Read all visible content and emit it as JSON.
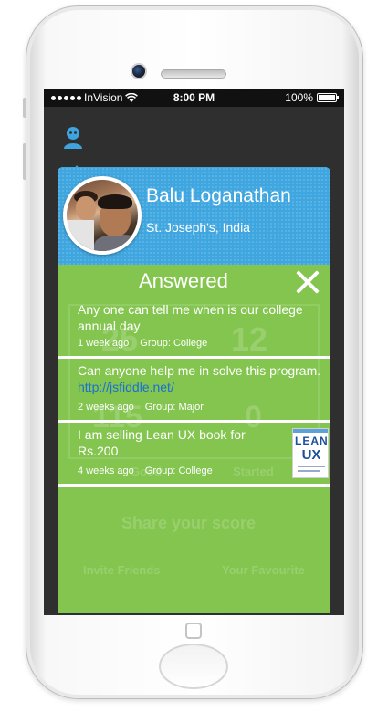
{
  "status_bar": {
    "carrier": "InVision",
    "time": "8:00 PM",
    "battery": "100%",
    "battery_level": 1.0
  },
  "profile": {
    "name": "Balu Loganathan",
    "location": "St. Joseph's, India"
  },
  "panel": {
    "title": "Answered"
  },
  "questions": [
    {
      "text": "Any one can tell me when is our college annual day",
      "link": "",
      "time": "1 week ago",
      "group": "Group: College"
    },
    {
      "text": "Can anyone help me in solve this program.",
      "link": "http://jsfiddle.net/",
      "time": "2 weeks ago",
      "group": "Group: Major"
    },
    {
      "text": "I am selling Lean UX book for Rs.200",
      "link": "",
      "time": "4 weeks ago",
      "group": "Group: College",
      "thumbnail": {
        "line1": "LEAN",
        "line2": "UX"
      }
    }
  ],
  "background": {
    "share": "Share your score",
    "invite": "Invite Friends",
    "favourite": "Your Favourite",
    "stat1": "25",
    "stat2": "12",
    "stat3": "115",
    "stat4": "0",
    "stat_label1": "Good",
    "stat_label2": "Started"
  },
  "colors": {
    "header_blue": "#3fa6e0",
    "panel_green": "#83c54f",
    "link_blue": "#1a6fd6"
  }
}
